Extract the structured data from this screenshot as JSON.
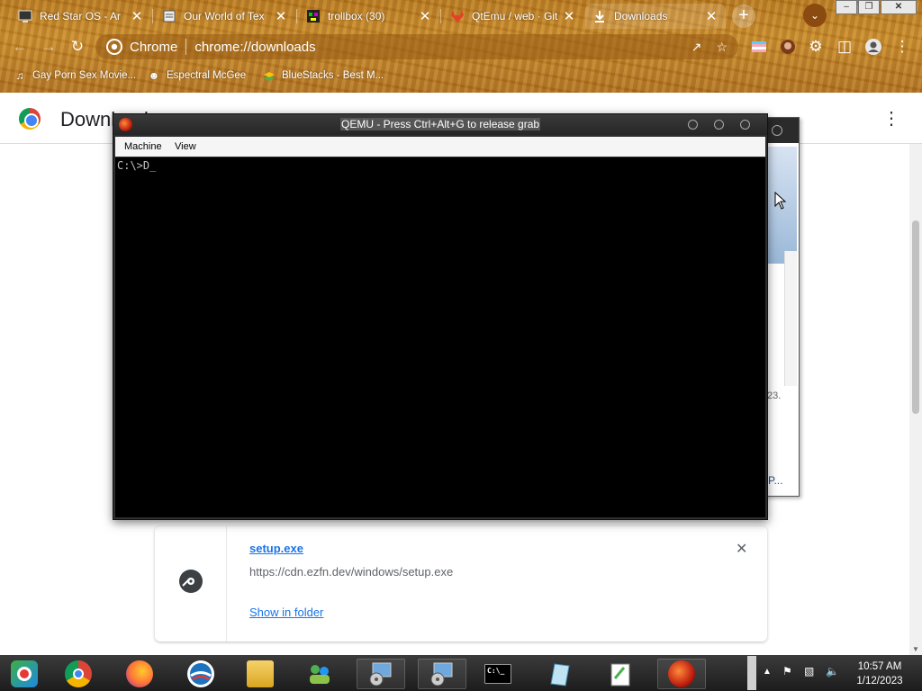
{
  "tabs": [
    {
      "title": "Red Star OS - Ar",
      "icon": "monitor-icon"
    },
    {
      "title": "Our World of Tex",
      "icon": "document-icon"
    },
    {
      "title": "trollbox (30)",
      "icon": "trollbox-icon"
    },
    {
      "title": "QtEmu / web · Git",
      "icon": "gitlab-icon"
    },
    {
      "title": "Downloads",
      "icon": "download-icon"
    }
  ],
  "toolbar": {
    "site_chip": "Chrome",
    "url": "chrome://downloads"
  },
  "bookmarks": [
    {
      "label": "Gay Porn Sex Movie...",
      "icon": "bookmark-favicon-icon"
    },
    {
      "label": "Espectral McGee",
      "icon": "bookmark-favicon-icon"
    },
    {
      "label": "BlueStacks - Best M...",
      "icon": "bluestacks-icon"
    }
  ],
  "downloads_page": {
    "title": "Downloads",
    "item": {
      "filename": "setup.exe",
      "url": "https://cdn.ezfn.dev/windows/setup.exe",
      "action": "Show in folder"
    }
  },
  "qemu": {
    "title": "QEMU - Press Ctrl+Alt+G to release grab",
    "menu": [
      "Machine",
      "View"
    ],
    "console_text": "C:\\>D_"
  },
  "background_window": {
    "fragment_text": "23.",
    "fragment_text2": "P..."
  },
  "taskbar": {
    "apps": [
      "Red Star OS launcher",
      "Google Chrome",
      "Firefox",
      "Opera",
      "File Manager",
      "Network",
      "VM Install 1",
      "VM Install 2",
      "Command Prompt",
      "Notepad",
      "Editor",
      "QEMU"
    ],
    "time": "10:57 AM",
    "date": "1/12/2023"
  },
  "colors": {
    "link": "#1a73e8",
    "wood": "#b8781e",
    "taskbar": "#2b2b2b"
  }
}
